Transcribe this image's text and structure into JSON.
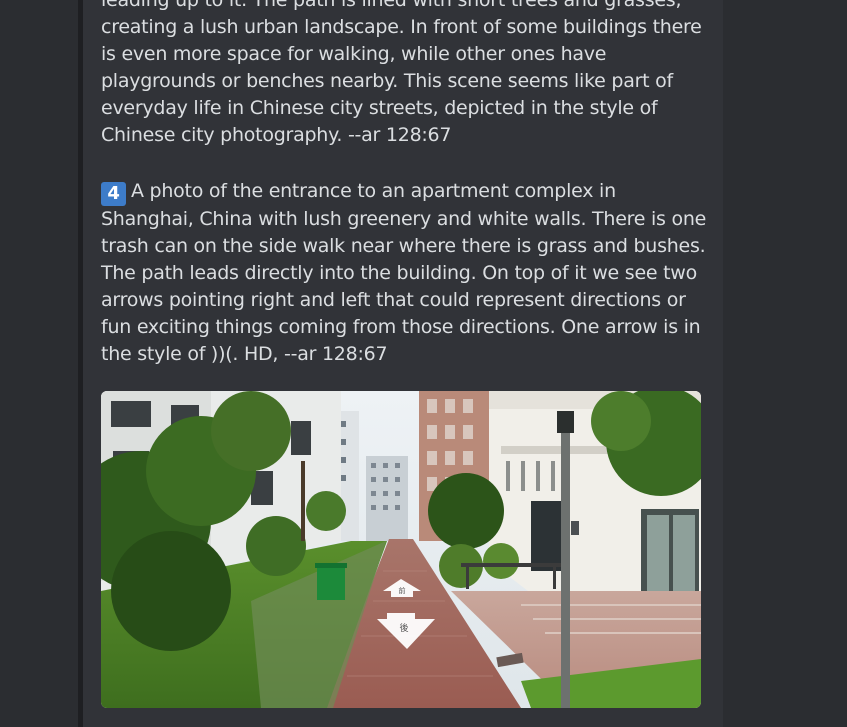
{
  "message": {
    "paragraph_1": "leading up to it. The path is lined with short trees and grasses, creating a lush urban landscape. In front of some buildings there is even more space for walking, while other ones have playgrounds or benches nearby. This scene seems like part of everyday life in Chinese city streets, depicted in the style of Chinese city photography. --ar 128:67",
    "paragraph_2_number": "4",
    "paragraph_2": "A photo of the entrance to an apartment complex in Shanghai, China with lush greenery and white walls. There is one trash can on the side walk near where there is grass and bushes. The path leads directly into the building. On top of it we see two arrows pointing right and left that could represent directions or fun exciting things coming from those directions. One arrow is in the style of ))(. HD, --ar 128:67"
  },
  "attachment": {
    "type": "street-view-photo",
    "arrow_up_label": "前",
    "arrow_down_label": "後"
  },
  "colors": {
    "chat_background": "#313338",
    "sidebar_background": "#2b2d31",
    "text": "#dbdee1",
    "keycap": "#3d7cc9"
  }
}
